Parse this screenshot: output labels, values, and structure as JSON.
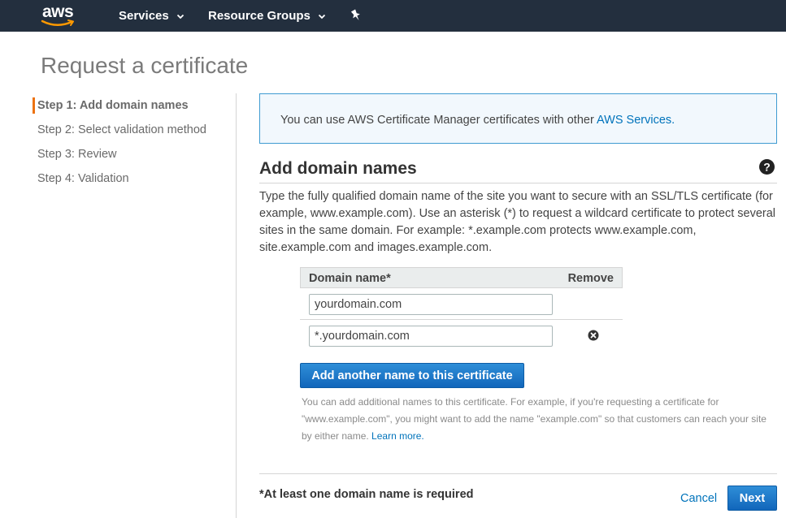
{
  "nav": {
    "logo_text": "aws",
    "services_label": "Services",
    "resource_groups_label": "Resource Groups"
  },
  "page": {
    "title": "Request a certificate"
  },
  "steps": [
    {
      "label": "Step 1: Add domain names",
      "active": true
    },
    {
      "label": "Step 2: Select validation method",
      "active": false
    },
    {
      "label": "Step 3: Review",
      "active": false
    },
    {
      "label": "Step 4: Validation",
      "active": false
    }
  ],
  "info": {
    "text": "You can use AWS Certificate Manager certificates with other ",
    "link_text": "AWS Services."
  },
  "section": {
    "title": "Add domain names",
    "description": "Type the fully qualified domain name of the site you want to secure with an SSL/TLS certificate (for example, www.example.com). Use an asterisk (*) to request a wildcard certificate to protect several sites in the same domain. For example: *.example.com protects www.example.com, site.example.com and images.example.com."
  },
  "table": {
    "col_domain": "Domain name*",
    "col_remove": "Remove",
    "rows": [
      {
        "value": "yourdomain.com"
      },
      {
        "value": "*.yourdomain.com"
      }
    ]
  },
  "add_button_label": "Add another name to this certificate",
  "hint": {
    "text": "You can add additional names to this certificate. For example, if you're requesting a certificate for \"www.example.com\", you might want to add the name \"example.com\" so that customers can reach your site by either name. ",
    "link_text": "Learn more."
  },
  "footer": {
    "required_note": "*At least one domain name is required",
    "cancel_label": "Cancel",
    "next_label": "Next"
  },
  "colors": {
    "nav_bg": "#232f3e",
    "accent_orange": "#ec7211",
    "link_blue": "#0073bb",
    "button_blue": "#1166bb"
  }
}
